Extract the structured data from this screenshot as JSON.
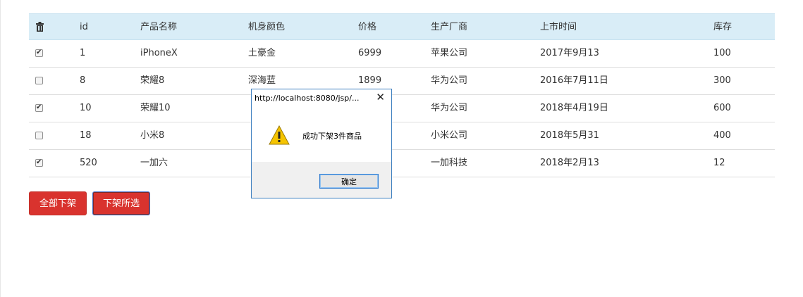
{
  "table": {
    "headers": [
      "",
      "id",
      "产品名称",
      "机身颜色",
      "价格",
      "生产厂商",
      "上市时间",
      "库存"
    ],
    "rows": [
      {
        "checked": true,
        "cells": [
          "1",
          "iPhoneX",
          "土豪金",
          "6999",
          "苹果公司",
          "2017年9月13",
          "100"
        ]
      },
      {
        "checked": false,
        "cells": [
          "8",
          "荣耀8",
          "深海蓝",
          "1899",
          "华为公司",
          "2016年7月11日",
          "300"
        ]
      },
      {
        "checked": true,
        "cells": [
          "10",
          "荣耀10",
          "",
          "",
          "华为公司",
          "2018年4月19日",
          "600"
        ]
      },
      {
        "checked": false,
        "cells": [
          "18",
          "小米8",
          "",
          "",
          "小米公司",
          "2018年5月31",
          "400"
        ]
      },
      {
        "checked": true,
        "cells": [
          "520",
          "一加六",
          "",
          "",
          "一加科技",
          "2018年2月13",
          "12"
        ]
      }
    ]
  },
  "buttons": {
    "all_label": "全部下架",
    "selected_label": "下架所选"
  },
  "dialog": {
    "title": "http://localhost:8080/jsp/...",
    "close_glyph": "✕",
    "message": "成功下架3件商品",
    "ok_label": "确定",
    "icon": "warning-icon"
  },
  "colors": {
    "header_bg": "#d9edf7",
    "button_red": "#d9332e",
    "dialog_border": "#3d7fbf"
  }
}
